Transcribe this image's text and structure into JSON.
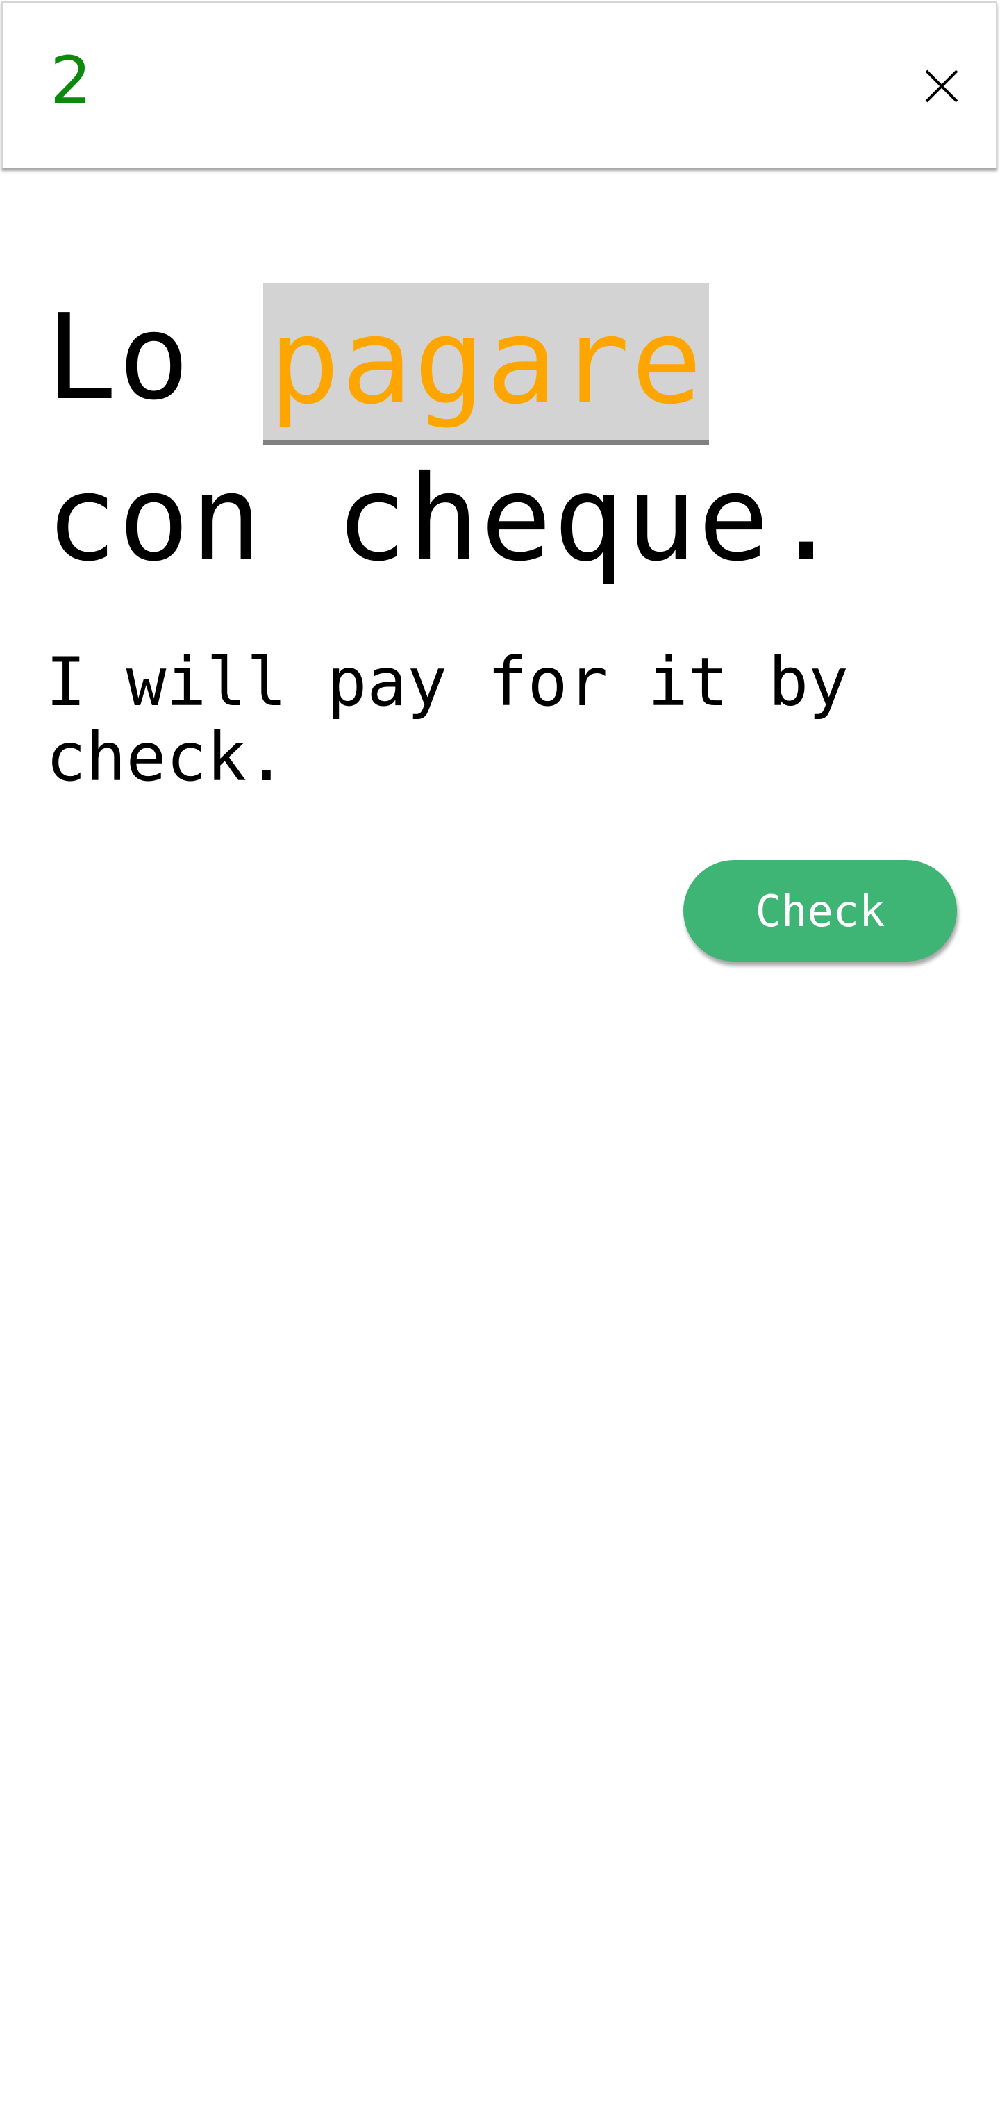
{
  "header": {
    "counter": "2",
    "counter_color": "#0c8a0c",
    "close_icon": "close-icon"
  },
  "exercise": {
    "sentence_before": "Lo ",
    "blank_word": "pagare",
    "sentence_after": " con cheque.",
    "translation": "I will pay for it by check."
  },
  "actions": {
    "check_label": "Check",
    "check_color": "#3eb574"
  },
  "colors": {
    "highlight_text": "#ffa500",
    "highlight_bg": "#d3d3d3"
  }
}
